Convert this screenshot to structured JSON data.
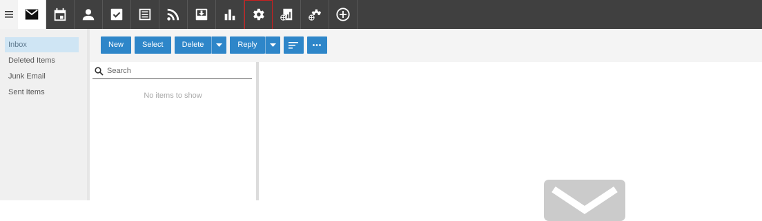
{
  "topbar": {
    "menu_icon": "hamburger-icon",
    "apps": [
      {
        "icon": "mail-icon",
        "active": true
      },
      {
        "icon": "calendar-icon"
      },
      {
        "icon": "contacts-icon"
      },
      {
        "icon": "tasks-icon"
      },
      {
        "icon": "notes-icon"
      },
      {
        "icon": "rss-icon"
      },
      {
        "icon": "inbox-tray-icon"
      },
      {
        "icon": "bar-chart-icon"
      },
      {
        "icon": "settings-gear-icon",
        "highlighted": true
      },
      {
        "icon": "web-report-icon"
      },
      {
        "icon": "web-settings-icon"
      },
      {
        "icon": "add-circle-icon"
      }
    ]
  },
  "sidebar": {
    "folders": [
      {
        "label": "Inbox",
        "selected": true
      },
      {
        "label": "Deleted Items"
      },
      {
        "label": "Junk Email"
      },
      {
        "label": "Sent Items"
      }
    ]
  },
  "toolbar": {
    "new_label": "New",
    "select_label": "Select",
    "delete_label": "Delete",
    "reply_label": "Reply",
    "sort_icon": "sort-icon",
    "more_icon": "more-icon"
  },
  "list": {
    "search_placeholder": "Search",
    "empty_text": "No items to show"
  },
  "reading_pane": {
    "placeholder_icon": "envelope-icon"
  },
  "colors": {
    "topbar": "#404040",
    "accent": "#2e86c9",
    "selected_folder": "#cfe5f4",
    "highlight_border": "#cc1f1f"
  }
}
